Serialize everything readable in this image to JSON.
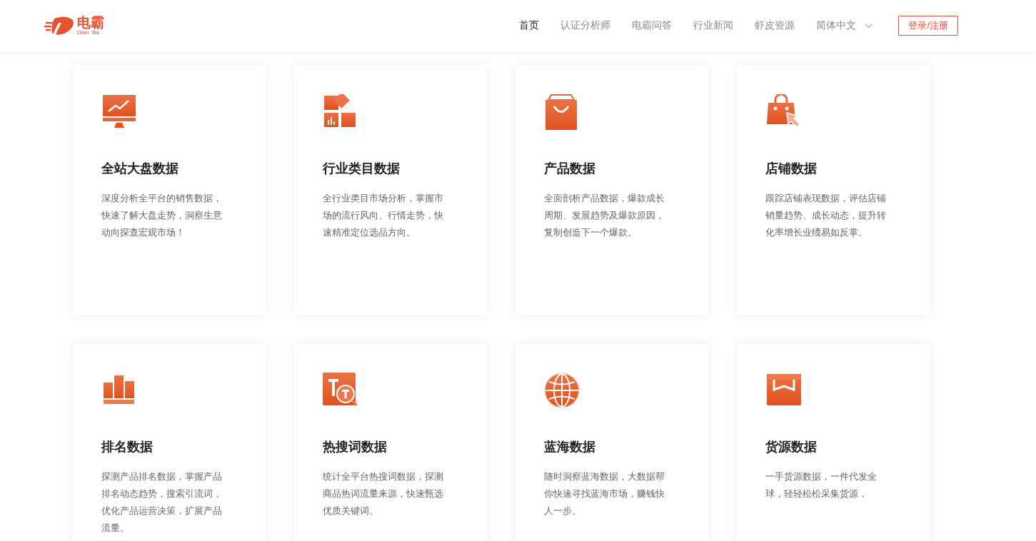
{
  "header": {
    "logo": {
      "name": "电霸",
      "subtitle": "Dian  Ba"
    },
    "nav": [
      {
        "label": "首页",
        "selected": true
      },
      {
        "label": "认证分析师",
        "selected": false
      },
      {
        "label": "电霸问答",
        "selected": false
      },
      {
        "label": "行业新闻",
        "selected": false
      },
      {
        "label": "虾皮资源",
        "selected": false
      }
    ],
    "language": "简体中文",
    "login": "登录/注册"
  },
  "cards": [
    {
      "title": "全站大盘数据",
      "description": "深度分析全平台的销售数据，快速了解大盘走势，洞察生意动向探查宏观市场！"
    },
    {
      "title": "行业类目数据",
      "description": "全行业类目市场分析，掌握市场的流行风向、行情走势，快速精准定位选品方向。"
    },
    {
      "title": "产品数据",
      "description": "全面剖析产品数据，爆款成长周期、发展趋势及爆款原因，复制创造下一个爆款。"
    },
    {
      "title": "店铺数据",
      "description": "跟踪店铺表现数据，评估店铺销量趋势、成长动态，提升转化率增长业绩易如反掌。"
    },
    {
      "title": "排名数据",
      "description": "探测产品排名数据，掌握产品排名动态趋势，搜索引流词，优化产品运营决策，扩展产品流量。"
    },
    {
      "title": "热搜词数据",
      "description": "统计全平台热搜词数据，探测商品热词流量来源，快速甄选优质关键词。"
    },
    {
      "title": "蓝海数据",
      "description": "随时洞察蓝海数据，大数据帮你快速寻找蓝海市场，赚钱快人一步。"
    },
    {
      "title": "货源数据",
      "description": "一手货源数据，一件代发全球，轻轻松松采集货源，"
    }
  ]
}
